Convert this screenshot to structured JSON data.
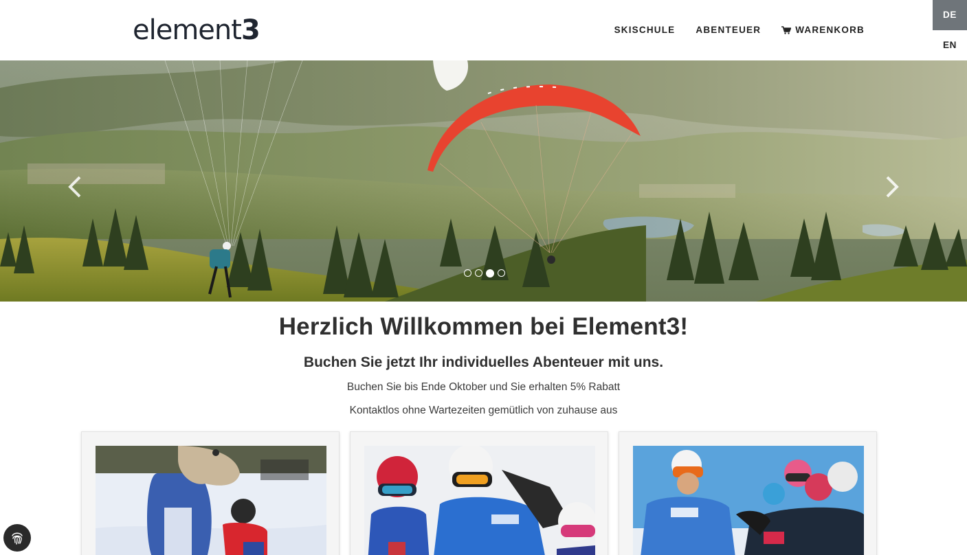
{
  "brand": {
    "logo_text": "element",
    "logo_digit": "3"
  },
  "nav": {
    "items": [
      {
        "label": "SKISCHULE"
      },
      {
        "label": "ABENTEUER"
      },
      {
        "label": "WARENKORB",
        "icon": "cart-icon"
      }
    ]
  },
  "languages": [
    {
      "code": "DE",
      "active": true
    },
    {
      "code": "EN",
      "active": false
    }
  ],
  "hero": {
    "slide_count": 4,
    "active_slide": 3,
    "prev_icon": "chevron-left-icon",
    "next_icon": "chevron-right-icon"
  },
  "intro": {
    "title": "Herzlich Willkommen bei Element3!",
    "subtitle": "Buchen Sie jetzt Ihr individuelles Abenteuer mit uns.",
    "line1": "Buchen Sie bis Ende Oktober und Sie erhalten 5% Rabatt",
    "line2": "Kontaktlos ohne Wartezeiten gemütlich von zuhause aus"
  },
  "cards": [
    {
      "image": "mascot-child-skiing"
    },
    {
      "image": "ski-instructor-kids"
    },
    {
      "image": "ski-group-high-five"
    }
  ],
  "colors": {
    "lang_active_bg": "#6f757a",
    "text_dark": "#2f2f2f",
    "paraglider_red": "#e8432f"
  },
  "fingerprint_badge": {
    "icon": "fingerprint-icon"
  }
}
